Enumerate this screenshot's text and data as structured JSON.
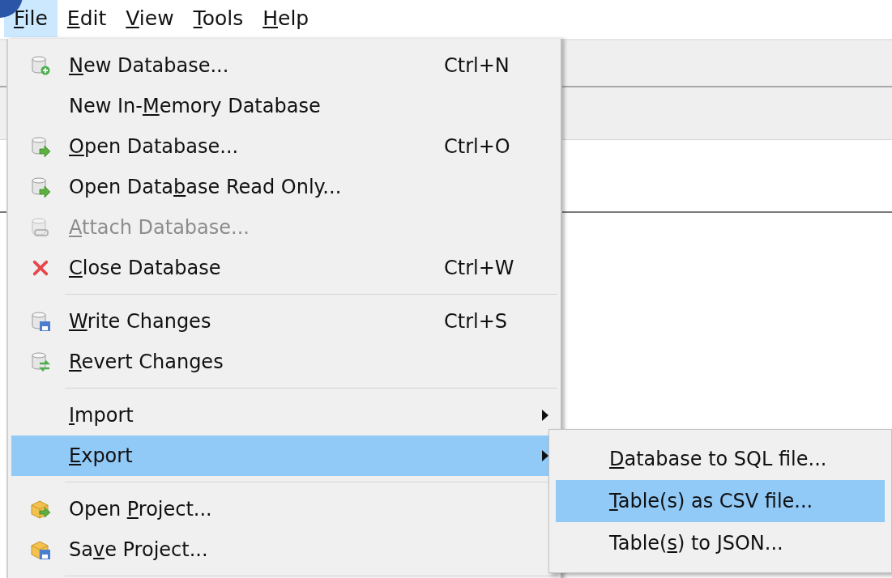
{
  "menubar": [
    {
      "label": {
        "key": "F",
        "post": "ile"
      },
      "selected": true
    },
    {
      "label": {
        "key": "E",
        "post": "dit"
      },
      "selected": false
    },
    {
      "label": {
        "key": "V",
        "post": "iew"
      },
      "selected": false
    },
    {
      "label": {
        "key": "T",
        "post": "ools"
      },
      "selected": false
    },
    {
      "label": {
        "key": "H",
        "post": "elp"
      },
      "selected": false
    }
  ],
  "file_menu": [
    {
      "kind": "item",
      "label": {
        "key": "N",
        "post": "ew Database..."
      },
      "shortcut": "Ctrl+N",
      "disabled": false,
      "selected": false
    },
    {
      "kind": "item",
      "label": {
        "pre": "New In-",
        "key": "M",
        "post": "emory Database"
      },
      "disabled": false,
      "selected": false
    },
    {
      "kind": "item",
      "label": {
        "key": "O",
        "post": "pen Database..."
      },
      "shortcut": "Ctrl+O",
      "disabled": false,
      "selected": false
    },
    {
      "kind": "item",
      "label": {
        "pre": "Open Data",
        "key": "b",
        "post": "ase Read Only..."
      },
      "disabled": false,
      "selected": false
    },
    {
      "kind": "item",
      "label": {
        "key": "A",
        "post": "ttach Database..."
      },
      "disabled": true,
      "selected": false
    },
    {
      "kind": "item",
      "label": {
        "key": "C",
        "post": "lose Database"
      },
      "shortcut": "Ctrl+W",
      "disabled": false,
      "selected": false
    },
    {
      "kind": "separator"
    },
    {
      "kind": "item",
      "label": {
        "key": "W",
        "post": "rite Changes"
      },
      "shortcut": "Ctrl+S",
      "disabled": false,
      "selected": false
    },
    {
      "kind": "item",
      "label": {
        "key": "R",
        "post": "evert Changes"
      },
      "disabled": false,
      "selected": false
    },
    {
      "kind": "separator"
    },
    {
      "kind": "item",
      "label": {
        "key": "I",
        "post": "mport"
      },
      "submenu": true,
      "disabled": false,
      "selected": false
    },
    {
      "kind": "item",
      "label": {
        "key": "E",
        "post": "xport"
      },
      "submenu": true,
      "disabled": false,
      "selected": true
    },
    {
      "kind": "separator"
    },
    {
      "kind": "item",
      "label": {
        "pre": "Open ",
        "key": "P",
        "post": "roject..."
      },
      "disabled": false,
      "selected": false
    },
    {
      "kind": "item",
      "label": {
        "pre": "Sa",
        "key": "v",
        "post": "e Project..."
      },
      "disabled": false,
      "selected": false
    },
    {
      "kind": "separator"
    }
  ],
  "export_submenu": [
    {
      "label": {
        "key": "D",
        "post": "atabase to SQL file..."
      },
      "selected": false
    },
    {
      "label": {
        "key": "T",
        "post": "able(s) as CSV file..."
      },
      "selected": true
    },
    {
      "label": {
        "pre": "Table(",
        "key": "s",
        "post": ") to JSON..."
      },
      "selected": false
    }
  ]
}
